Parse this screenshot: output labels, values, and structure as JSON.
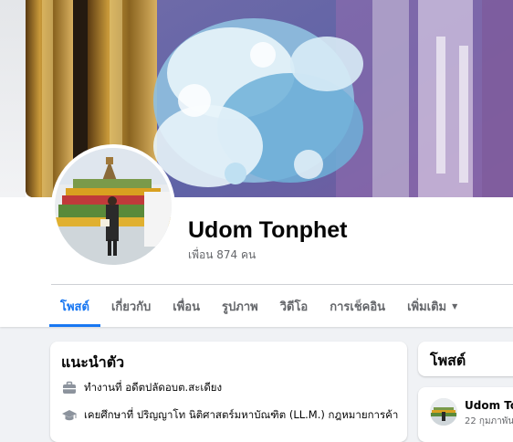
{
  "profile": {
    "name": "Udom Tonphet",
    "friends_count": "เพื่อน 874 คน"
  },
  "tabs": [
    {
      "label": "โพสต์",
      "active": true
    },
    {
      "label": "เกี่ยวกับ",
      "active": false
    },
    {
      "label": "เพื่อน",
      "active": false
    },
    {
      "label": "รูปภาพ",
      "active": false
    },
    {
      "label": "วิดีโอ",
      "active": false
    },
    {
      "label": "การเช็คอิน",
      "active": false
    },
    {
      "label": "เพิ่มเติม",
      "active": false,
      "icon": "caret-down-icon"
    }
  ],
  "intro": {
    "title": "แนะนำตัว",
    "items": [
      {
        "icon": "briefcase-icon",
        "text": "ทำงานที่ อดีตปลัดอบต.สะเดียง"
      },
      {
        "icon": "graduation-cap-icon",
        "text": "เคยศึกษาที่ ปริญญาโท นิติศาสตร์มหาบัณฑิต (LL.M.) กฎหมายการค้า"
      }
    ]
  },
  "posts": {
    "title": "โพสต์",
    "first_post": {
      "author": "Udom Ton",
      "date": "22 กุมภาพัน"
    }
  },
  "colors": {
    "accent": "#1877f2",
    "secondary_text": "#65676b",
    "page_background": "#f0f2f5"
  }
}
